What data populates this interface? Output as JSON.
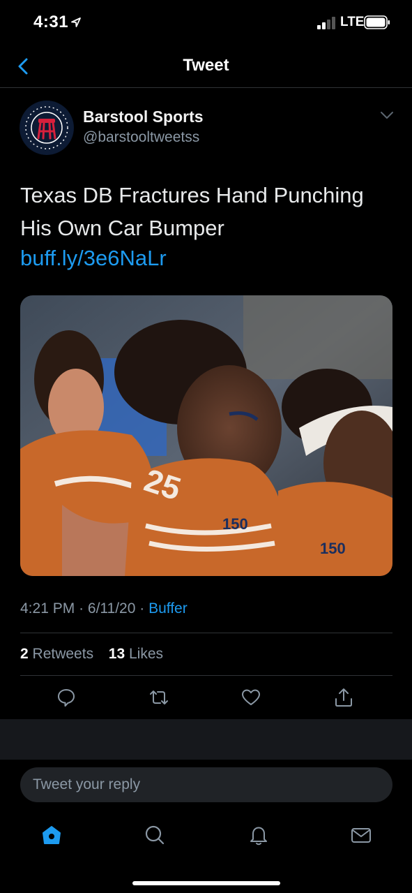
{
  "status": {
    "time": "4:31",
    "network": "LTE"
  },
  "nav": {
    "title": "Tweet"
  },
  "author": {
    "name": "Barstool Sports",
    "handle": "@barstooltweetss"
  },
  "tweet": {
    "text": "Texas DB Fractures Hand Punching His Own Car Bumper",
    "link": "buff.ly/3e6NaLr",
    "time": "4:21 PM",
    "date": "6/11/20",
    "source": "Buffer",
    "retweets": "2",
    "retweets_label": "Retweets",
    "likes": "13",
    "likes_label": "Likes"
  },
  "media": {
    "jersey_number": "25",
    "patch": "150"
  },
  "reply": {
    "placeholder": "Tweet your reply"
  },
  "icons": {
    "back": "chevron-left-icon",
    "caret": "chevron-down-icon",
    "reply": "comment-icon",
    "retweet": "retweet-icon",
    "like": "heart-icon",
    "share": "share-icon",
    "home": "home-icon",
    "search": "search-icon",
    "notifications": "bell-icon",
    "messages": "mail-icon"
  },
  "colors": {
    "accent": "#1d9bf0",
    "background": "#000000",
    "secondary_text": "#8b98a5",
    "jersey": "#c8682a"
  }
}
